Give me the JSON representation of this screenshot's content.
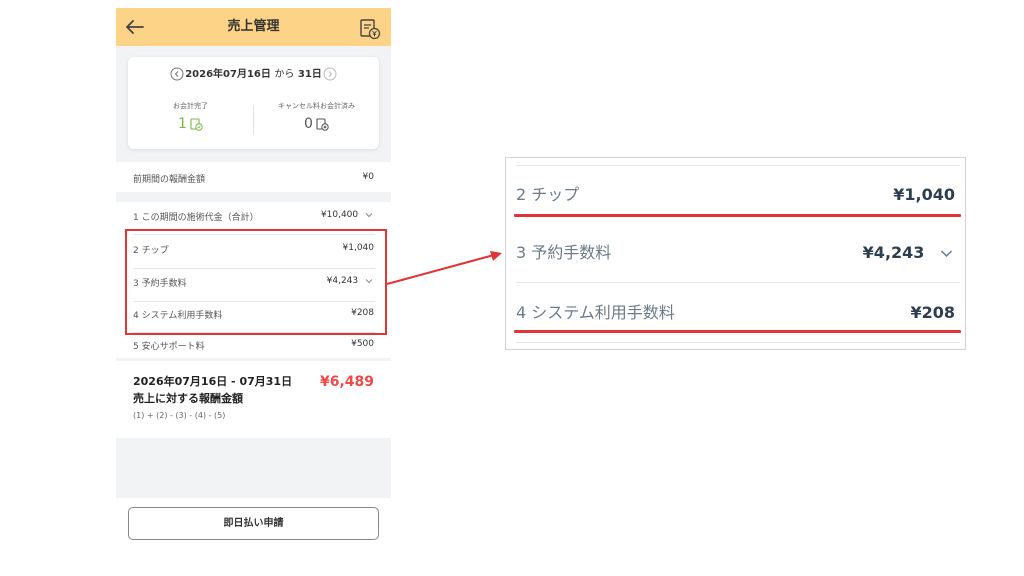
{
  "header": {
    "title": "売上管理"
  },
  "summary": {
    "date_start": "2026年07月16日",
    "connector": "から",
    "date_end": "31日",
    "completed_label": "お会計完了",
    "completed_count": "1",
    "cancel_label": "キャンセル料お会計済み",
    "cancel_count": "0"
  },
  "previous": {
    "label": "前期間の報酬金額",
    "value": "¥0"
  },
  "items": [
    {
      "label": "1  この期間の施術代金（合計）",
      "value": "¥10,400"
    },
    {
      "label": "2  チップ",
      "value": "¥1,040"
    },
    {
      "label": "3  予約手数料",
      "value": "¥4,243"
    },
    {
      "label": "4  システム利用手数料",
      "value": "¥208"
    },
    {
      "label": "5  安心サポート料",
      "value": "¥500"
    }
  ],
  "total": {
    "line1": "2026年07月16日 - 07月31日",
    "line2": "売上に対する報酬金額",
    "formula": "(1) + (2) - (3) - (4) - (5)",
    "amount": "¥6,489"
  },
  "action_button": "即日払い申請",
  "zoom": {
    "rows": [
      {
        "label": "2  チップ",
        "value": "¥1,040"
      },
      {
        "label": "3  予約手数料",
        "value": "¥4,243"
      },
      {
        "label": "4  システム利用手数料",
        "value": "¥208"
      }
    ]
  },
  "colors": {
    "header_bg": "#fcd387",
    "accent_green": "#7ab648",
    "total_red": "#ef4a4a",
    "highlight_red": "#e23434"
  }
}
